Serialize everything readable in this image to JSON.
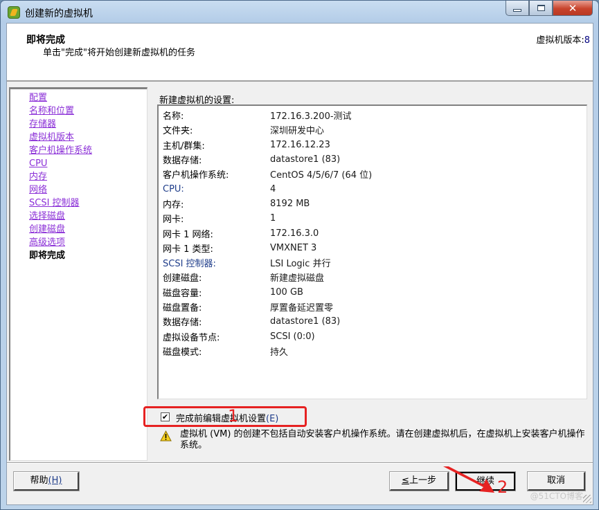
{
  "window": {
    "title": "创建新的虚拟机",
    "controls": {
      "minimize": "minimize",
      "maximize": "maximize",
      "close": "close"
    }
  },
  "header": {
    "title": "即将完成",
    "subtitle": "单击\"完成\"将开始创建新虚拟机的任务",
    "version_label": "虚拟机版本:",
    "version_value": "8"
  },
  "nav": {
    "items": [
      {
        "label": "配置",
        "current": false
      },
      {
        "label": "名称和位置",
        "current": false
      },
      {
        "label": "存储器",
        "current": false
      },
      {
        "label": "虚拟机版本",
        "current": false
      },
      {
        "label": "客户机操作系统",
        "current": false
      },
      {
        "label": "CPU",
        "current": false
      },
      {
        "label": "内存",
        "current": false
      },
      {
        "label": "网络",
        "current": false
      },
      {
        "label": "SCSI 控制器",
        "current": false
      },
      {
        "label": "选择磁盘",
        "current": false
      },
      {
        "label": "创建磁盘",
        "current": false
      },
      {
        "label": "高级选项",
        "current": false
      },
      {
        "label": "即将完成",
        "current": true
      }
    ]
  },
  "settings": {
    "label": "新建虚拟机的设置:",
    "rows": [
      {
        "key": "名称:",
        "value": "172.16.3.200-测试"
      },
      {
        "key": "文件夹:",
        "value": "深圳研发中心"
      },
      {
        "key": "主机/群集:",
        "value": "172.16.12.23"
      },
      {
        "key": "数据存储:",
        "value": "datastore1 (83)"
      },
      {
        "key": "客户机操作系统:",
        "value": "CentOS 4/5/6/7 (64 位)"
      },
      {
        "key": "CPU:",
        "value": "4"
      },
      {
        "key": "内存:",
        "value": "8192 MB"
      },
      {
        "key": "网卡:",
        "value": "1"
      },
      {
        "key": "网卡 1 网络:",
        "value": "172.16.3.0"
      },
      {
        "key": "网卡 1 类型:",
        "value": "VMXNET 3"
      },
      {
        "key": "SCSI 控制器:",
        "value": "LSI Logic 并行"
      },
      {
        "key": "创建磁盘:",
        "value": "新建虚拟磁盘"
      },
      {
        "key": "磁盘容量:",
        "value": "100 GB"
      },
      {
        "key": "磁盘置备:",
        "value": "厚置备延迟置零"
      },
      {
        "key": "数据存储:",
        "value": "datastore1 (83)"
      },
      {
        "key": "虚拟设备节点:",
        "value": "SCSI (0:0)"
      },
      {
        "key": "磁盘模式:",
        "value": "持久"
      }
    ]
  },
  "edit_before_finish": {
    "checked": true,
    "check_glyph": "✔",
    "label": "完成前编辑虚拟机设置",
    "accelerator": "(E)"
  },
  "warning": {
    "text": "虚拟机 (VM) 的创建不包括自动安装客户机操作系统。请在创建虚拟机后，在虚拟机上安装客户机操作系统。"
  },
  "buttons": {
    "help": "帮助",
    "help_accel": "(H)",
    "back_accel": "≤",
    "back": "上一步",
    "next": "继续",
    "cancel": "取消"
  },
  "annotations": {
    "step1": "1",
    "step2": "2"
  },
  "watermark": "@51CTO博客"
}
